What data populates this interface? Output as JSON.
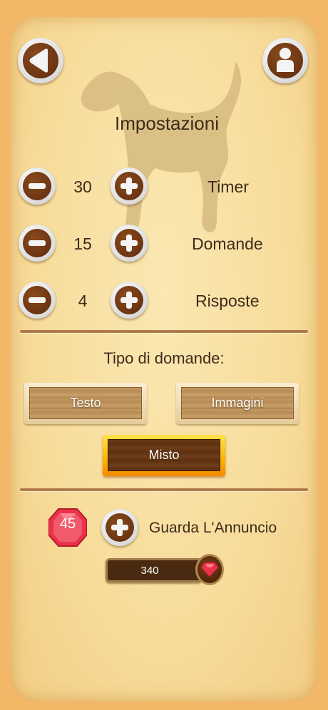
{
  "header": {
    "title": "Impostazioni"
  },
  "settings": [
    {
      "value": "30",
      "label": "Timer"
    },
    {
      "value": "15",
      "label": "Domande"
    },
    {
      "value": "4",
      "label": "Risposte"
    }
  ],
  "question_type": {
    "heading": "Tipo di domande:",
    "options": [
      "Testo",
      "Immagini",
      "Misto"
    ],
    "selected": "Misto"
  },
  "reward": {
    "gems": "45",
    "watch_ad_label": "Guarda L'Annuncio",
    "balance": "340"
  },
  "icons": {
    "back": "back-arrow-icon",
    "profile": "profile-icon",
    "minus": "minus-icon",
    "plus": "plus-icon",
    "gem": "gem-icon",
    "background": "dog-silhouette"
  },
  "colors": {
    "background": "#f2b868",
    "panel": "#f8e0a4",
    "button_brown": "#6b3512",
    "selected_border": "#ffb300",
    "gem_red": "#e8344a"
  }
}
